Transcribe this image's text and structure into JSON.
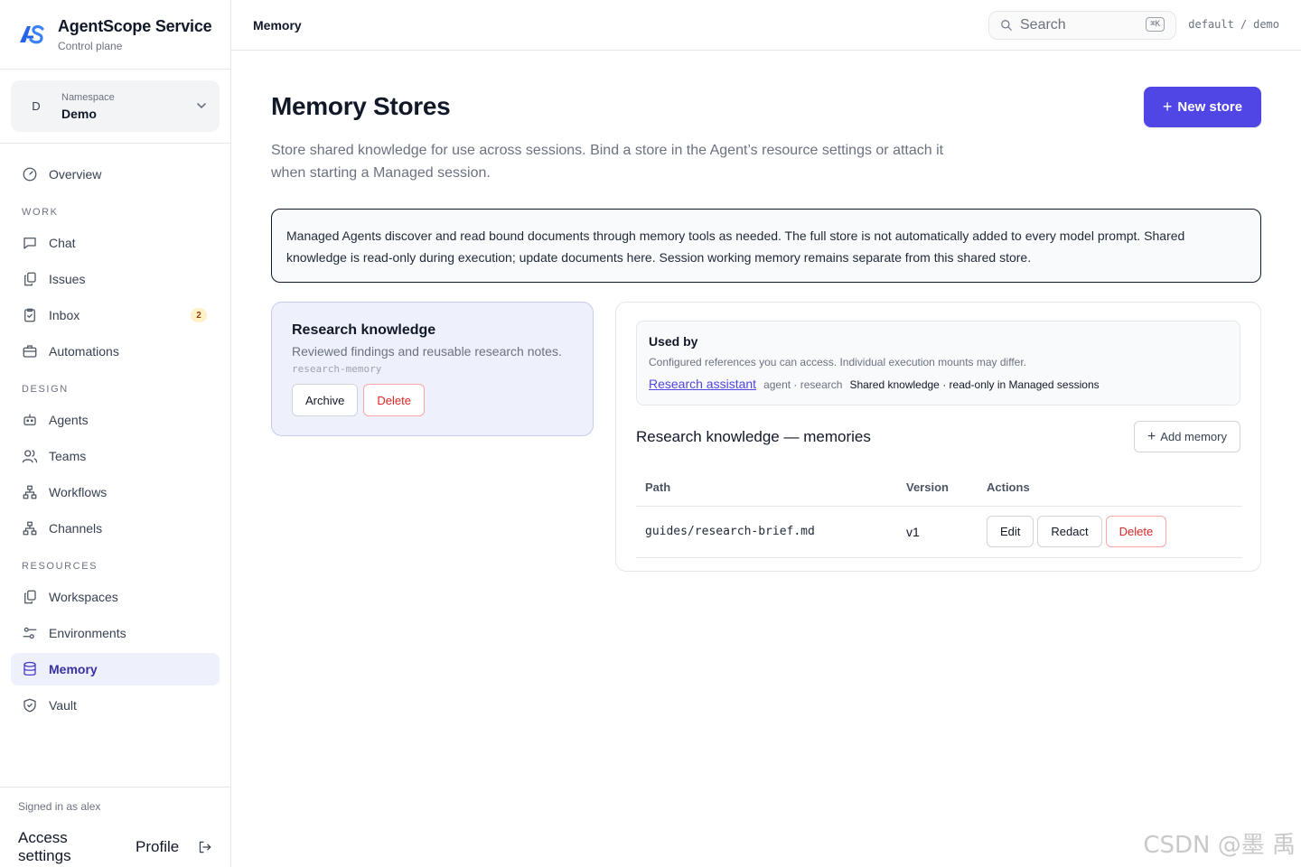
{
  "brand": {
    "title": "AgentScope Service",
    "subtitle": "Control plane"
  },
  "namespace": {
    "label": "Namespace",
    "value": "Demo",
    "avatar": "D"
  },
  "nav": {
    "overview": "Overview",
    "work_section": "WORK",
    "chat": "Chat",
    "issues": "Issues",
    "inbox": "Inbox",
    "inbox_badge": "2",
    "automations": "Automations",
    "design_section": "DESIGN",
    "agents": "Agents",
    "teams": "Teams",
    "workflows": "Workflows",
    "channels": "Channels",
    "resources_section": "RESOURCES",
    "workspaces": "Workspaces",
    "environments": "Environments",
    "memory": "Memory",
    "vault": "Vault"
  },
  "footer": {
    "signed_in": "Signed in as alex",
    "access_settings": "Access settings",
    "profile": "Profile"
  },
  "header": {
    "title": "Memory",
    "search_placeholder": "Search",
    "shortcut": "⌘K",
    "crumb_org": "default",
    "crumb_sep": "/",
    "crumb_ns": "demo"
  },
  "page": {
    "title": "Memory Stores",
    "new_button": "New store",
    "description": "Store shared knowledge for use across sessions. Bind a store in the Agent’s resource settings or attach it when starting a Managed session.",
    "notice": "Managed Agents discover and read bound documents through memory tools as needed. The full store is not automatically added to every model prompt. Shared knowledge is read-only during execution; update documents here. Session working memory remains separate from this shared store."
  },
  "store": {
    "name": "Research knowledge",
    "description": "Reviewed findings and reusable research notes.",
    "slug": "research-memory",
    "archive": "Archive",
    "delete": "Delete"
  },
  "used_by": {
    "title": "Used by",
    "subtitle": "Configured references you can access. Individual execution mounts may differ.",
    "link": "Research assistant",
    "kind": "agent · research",
    "note": "Shared knowledge · read-only in Managed sessions"
  },
  "memories": {
    "title": "Research knowledge — memories",
    "add_button": "Add memory",
    "columns": {
      "path": "Path",
      "version": "Version",
      "actions": "Actions"
    },
    "rows": [
      {
        "path": "guides/research-brief.md",
        "version": "v1",
        "edit": "Edit",
        "redact": "Redact",
        "delete": "Delete"
      }
    ]
  },
  "watermark": "CSDN @墨 禹",
  "colors": {
    "accent": "#4f46e5",
    "danger": "#dc2626",
    "active_bg": "#eef0fb"
  }
}
